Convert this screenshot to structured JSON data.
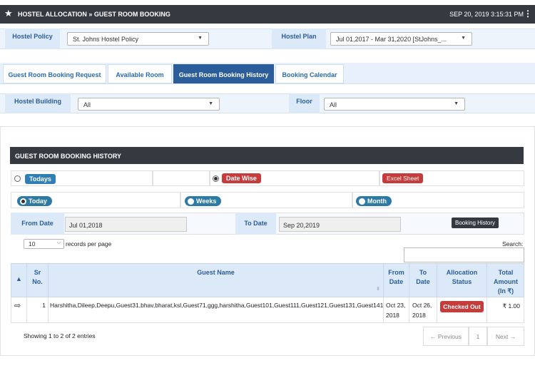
{
  "header": {
    "title": "HOSTEL ALLOCATION » GUEST ROOM BOOKING",
    "datetime": "SEP 20, 2019  3:15:31 PM",
    "kebab": "⋮",
    "star": "★"
  },
  "policy": {
    "policy_label": "Hostel Policy",
    "policy_value": "St. Johns Hostel Policy",
    "plan_label": "Hostel Plan",
    "plan_value": "Jul 01,2017 - Mar 31,2020 [StJohns_..."
  },
  "tabs": [
    {
      "label": "Guest Room Booking Request"
    },
    {
      "label": "Available Room"
    },
    {
      "label": "Guest Room Booking History"
    },
    {
      "label": "Booking Calendar"
    }
  ],
  "filters": {
    "building_label": "Hostel Building",
    "building_value": "All",
    "floor_label": "Floor",
    "floor_value": "All"
  },
  "history": {
    "title": "GUEST ROOM BOOKING HISTORY",
    "todays": "Todays",
    "date_wise": "Date Wise",
    "excel": "Excel Sheet",
    "today": "Today",
    "weeks": "Weeks",
    "month": "Month",
    "from_label": "From Date",
    "from_value": "Jul 01,2018",
    "to_label": "To Date",
    "to_value": "Sep 20,2019",
    "booking_btn": "Booking History"
  },
  "table": {
    "page_size": "10",
    "records_label": "records per page",
    "search_label": "Search:",
    "search_value": "",
    "columns": {
      "sr1": "Sr",
      "sr2": "No.",
      "guest": "Guest Name",
      "from1": "From",
      "from2": "Date",
      "to1": "To",
      "to2": "Date",
      "alloc1": "Allocation",
      "alloc2": "Status",
      "amt1": "Total",
      "amt2": "Amount",
      "amt3": "(In ₹)"
    },
    "rows": [
      {
        "sr": "1",
        "guest": "Harshitha,Dileep,Deepu,Guest31,bhav,bharat,ksl,Guest71,ggg,harshitha,Guest101,Guest111,Guest121,Guest131,Guest141",
        "from1": "Oct 23,",
        "from2": "2018",
        "to1": "Oct 26,",
        "to2": "2018",
        "status": "Checked Out",
        "amount": "₹ 1.00"
      }
    ],
    "info": "Showing 1 to 2 of 2 entries",
    "prev": "← Previous",
    "page": "1",
    "next": "Next →"
  },
  "colors": {
    "header_bg": "#343a40",
    "tab_active": "#2a5d9a",
    "label_bg": "#dce9f8",
    "red_badge": "#c63b3b",
    "blue_badge": "#2f7fb6"
  }
}
